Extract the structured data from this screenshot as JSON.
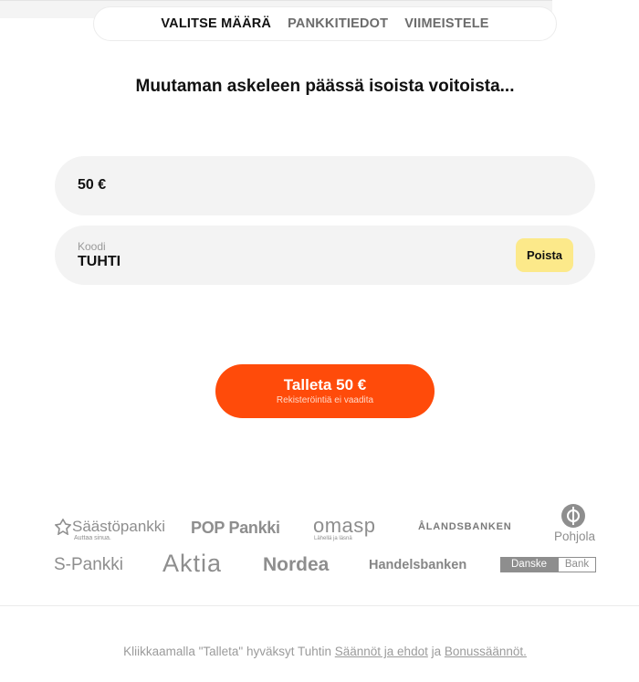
{
  "steps": {
    "step1": "VALITSE MÄÄRÄ",
    "step2": "PANKKITIEDOT",
    "step3": "VIIMEISTELE"
  },
  "heading": "Muutaman askeleen päässä isoista voitoista...",
  "amount": {
    "value": "50 €"
  },
  "code": {
    "label": "Koodi",
    "value": "TUHTI",
    "remove_label": "Poista"
  },
  "cta": {
    "title": "Talleta 50 €",
    "subtitle": "Rekisteröintiä ei vaadita"
  },
  "banks": {
    "saastopankki": "Säästöpankki",
    "saastopankki_tagline": "Auttaa sinua.",
    "poppankki": "POP Pankki",
    "omasp": "omasp",
    "omasp_tagline": "Lähellä ja läsnä",
    "alandsbanken": "ÅLANDSBANKEN",
    "pohjola": "Pohjola",
    "spankki": "S-Pankki",
    "aktia": "Aktia",
    "nordea": "Nordea",
    "handelsbanken": "Handelsbanken",
    "danske_left": "Danske",
    "danske_right": "Bank"
  },
  "footer": {
    "prefix": "Kliikkaamalla \"Talleta\" hyväksyt Tuhtin ",
    "terms_link": "Säännöt ja ehdot",
    "middle": " ja ",
    "bonus_link": "Bonussäännöt."
  }
}
